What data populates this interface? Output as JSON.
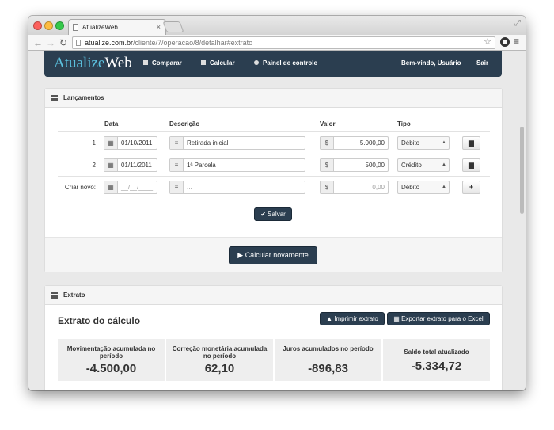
{
  "browser": {
    "tab_title": "AtualizeWeb",
    "url_host": "atualize.com.br",
    "url_path": "/cliente/7/operacao/8/detalhar#extrato"
  },
  "navbar": {
    "brand_part1": "Atualize",
    "brand_part2": "Web",
    "comparar": "Comparar",
    "calcular": "Calcular",
    "painel": "Painel de controle",
    "welcome": "Bem-vindo, Usuário",
    "sair": "Sair"
  },
  "lancamentos": {
    "title": "Lançamentos",
    "headers": {
      "data": "Data",
      "descricao": "Descrição",
      "valor": "Valor",
      "tipo": "Tipo"
    },
    "currency": "$",
    "rows": [
      {
        "num": "1",
        "data": "01/10/2011",
        "descricao": "Retirada inicial",
        "valor": "5.000,00",
        "tipo": "Débito"
      },
      {
        "num": "2",
        "data": "01/11/2011",
        "descricao": "1ª Parcela",
        "valor": "500,00",
        "tipo": "Crédito"
      }
    ],
    "new_row": {
      "label": "Criar novo:",
      "data": "__/__/____",
      "descricao": "...",
      "valor": "0,00",
      "tipo": "Débito"
    },
    "salvar": "Salvar",
    "calcular_novamente": "Calcular novamente"
  },
  "extrato": {
    "title": "Extrato",
    "heading": "Extrato do cálculo",
    "imprimir": "Imprimir extrato",
    "exportar": "Exportar extrato para o Excel",
    "stats": [
      {
        "label": "Movimentação acumulada no período",
        "value": "-4.500,00"
      },
      {
        "label": "Correção monetária acumulada no período",
        "value": "62,10"
      },
      {
        "label": "Juros acumulados no período",
        "value": "-896,83"
      },
      {
        "label": "Saldo total atualizado",
        "value": "-5.334,72"
      }
    ]
  },
  "colors": {
    "navbar": "#2b3e50",
    "brand_accent": "#5bc0de"
  }
}
